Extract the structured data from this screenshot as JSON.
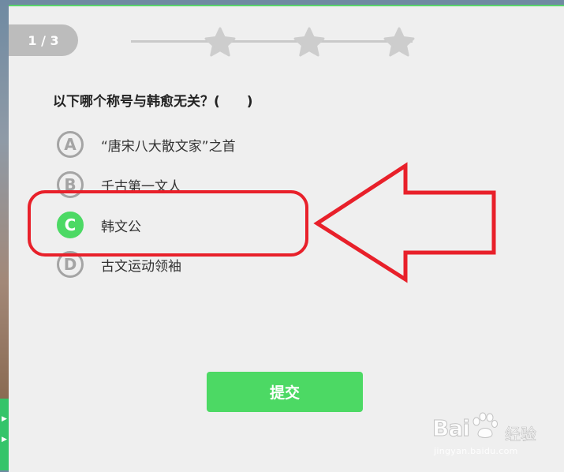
{
  "progress": {
    "label": "1 / 3",
    "stars_total": 3
  },
  "question": {
    "text": "以下哪个称号与韩愈无关？(　　)"
  },
  "options": [
    {
      "letter": "A",
      "text": "“唐宋八大散文家”之首",
      "selected": false
    },
    {
      "letter": "B",
      "text": "千古第一文人",
      "selected": false
    },
    {
      "letter": "C",
      "text": "韩文公",
      "selected": true
    },
    {
      "letter": "D",
      "text": "古文运动领袖",
      "selected": false
    }
  ],
  "submit": {
    "label": "提交"
  },
  "watermark": {
    "brand": "Bai",
    "suffix": "经验",
    "url": "jingyan.baidu.com"
  },
  "colors": {
    "accent": "#4cd964",
    "annotation": "#e8202a",
    "inactive": "#a4a4a4"
  }
}
